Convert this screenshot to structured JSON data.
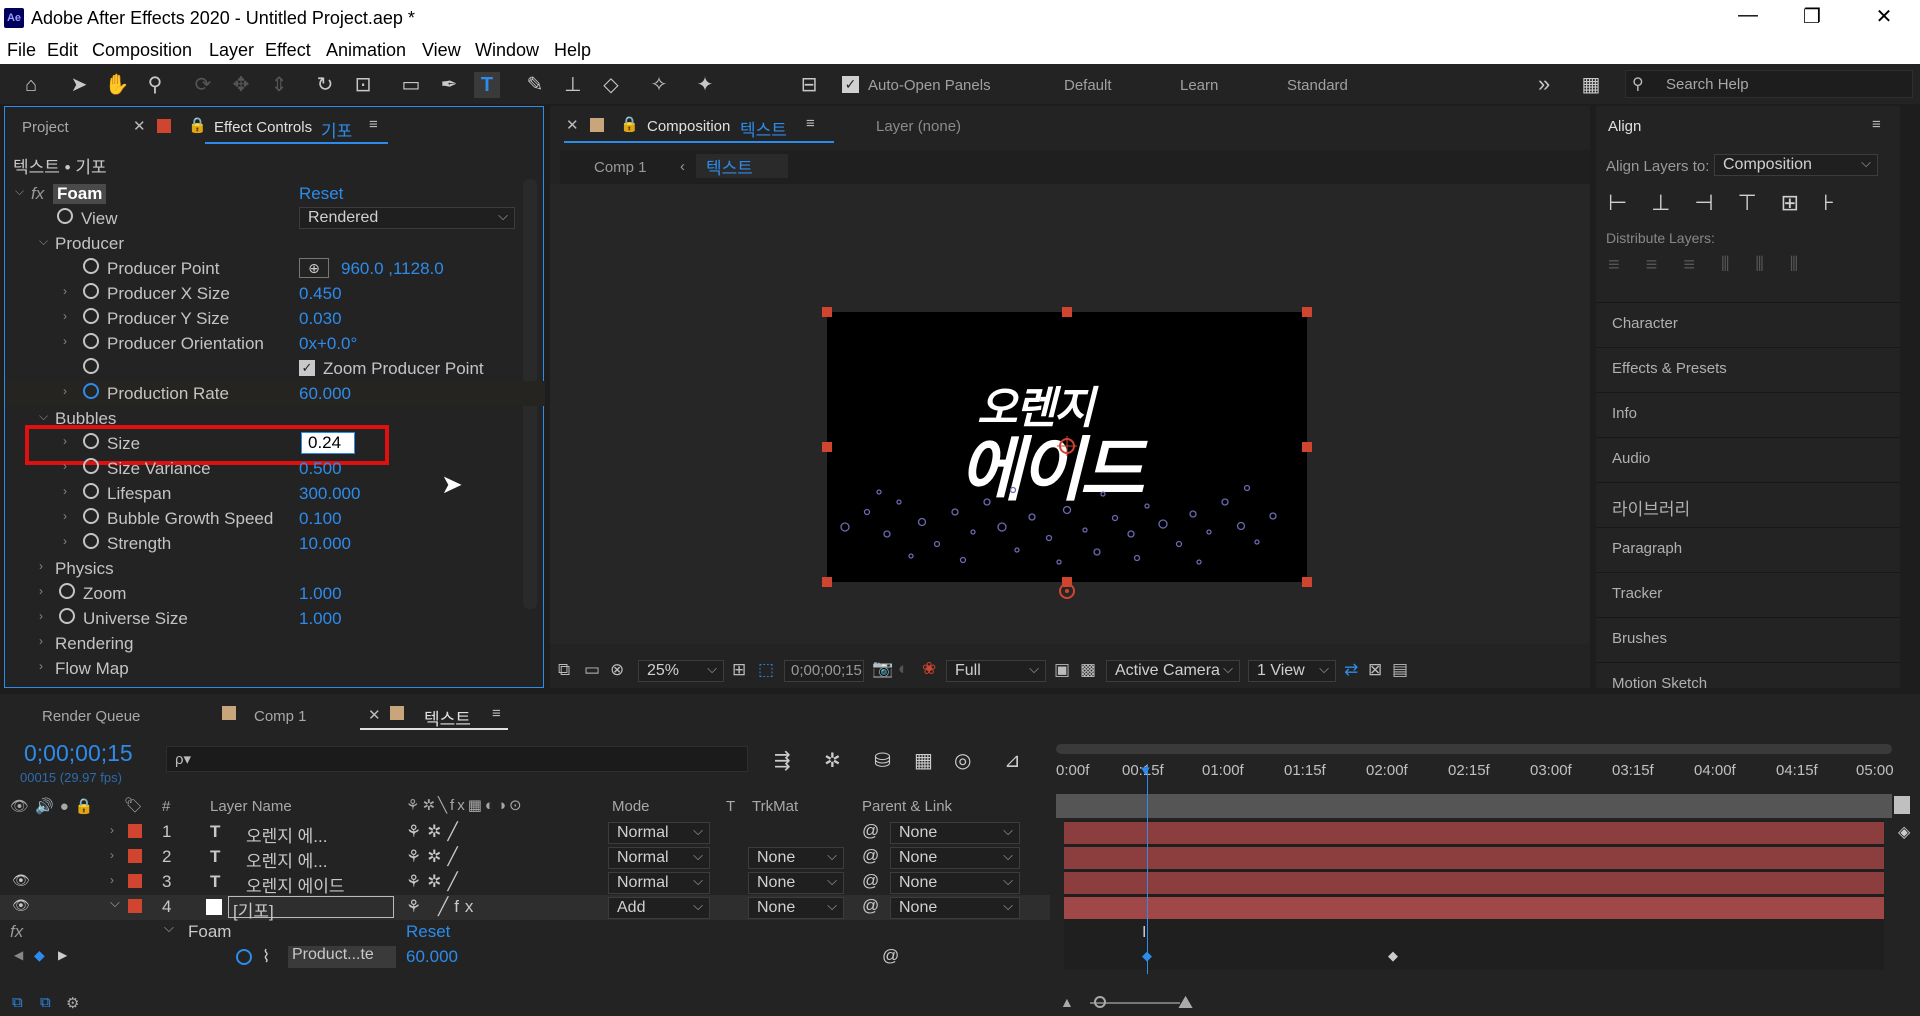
{
  "window": {
    "title": "Adobe After Effects 2020 - Untitled Project.aep *",
    "logo": "Ae",
    "minimize": "—",
    "restore": "❐",
    "close": "✕"
  },
  "menu": [
    "File",
    "Edit",
    "Composition",
    "Layer",
    "Effect",
    "Animation",
    "View",
    "Window",
    "Help"
  ],
  "toolbar": {
    "auto_open": "Auto-Open Panels",
    "workspaces": [
      "Default",
      "Learn",
      "Standard"
    ],
    "more": "»",
    "search_placeholder": "Search Help"
  },
  "effect_panel": {
    "tab_project": "Project",
    "tab_label": "Effect Controls",
    "tab_layer": "기포",
    "path": "텍스트 • 기포",
    "effect_name": "Foam",
    "reset": "Reset",
    "rows": [
      {
        "label": "View",
        "value": "Rendered"
      },
      {
        "label": "Producer"
      },
      {
        "label": "Producer Point",
        "value": "960.0 ,1128.0"
      },
      {
        "label": "Producer X Size",
        "value": "0.450"
      },
      {
        "label": "Producer Y Size",
        "value": "0.030"
      },
      {
        "label": "Producer Orientation",
        "value": "0x+0.0°"
      },
      {
        "label": "Zoom Producer Point"
      },
      {
        "label": "Production Rate",
        "value": "60.000"
      },
      {
        "label": "Bubbles"
      },
      {
        "label": "Size",
        "value": "0.24"
      },
      {
        "label": "Size Variance",
        "value": "0.500"
      },
      {
        "label": "Lifespan",
        "value": "300.000"
      },
      {
        "label": "Bubble Growth Speed",
        "value": "0.100"
      },
      {
        "label": "Strength",
        "value": "10.000"
      },
      {
        "label": "Physics"
      },
      {
        "label": "Zoom",
        "value": "1.000"
      },
      {
        "label": "Universe Size",
        "value": "1.000"
      },
      {
        "label": "Rendering"
      },
      {
        "label": "Flow Map"
      }
    ]
  },
  "comp_panel": {
    "tab_label": "Composition",
    "tab_comp": "텍스트",
    "layer_tab": "Layer (none)",
    "breadcrumb_1": "Comp 1",
    "breadcrumb_2": "텍스트",
    "art_line1": "오렌지",
    "art_line2": "에이드",
    "zoom": "25%",
    "timecode": "0;00;00;15",
    "resolution": "Full",
    "camera": "Active Camera",
    "views": "1 View"
  },
  "right_panel": {
    "align_title": "Align",
    "align_to_label": "Align Layers to:",
    "align_to_value": "Composition",
    "distribute_label": "Distribute Layers:",
    "panels": [
      "Character",
      "Effects & Presets",
      "Info",
      "Audio",
      "라이브러리",
      "Paragraph",
      "Tracker",
      "Brushes",
      "Motion Sketch"
    ]
  },
  "timeline": {
    "tabs": [
      "Render Queue",
      "Comp 1",
      "텍스트"
    ],
    "timecode": "0;00;00;15",
    "fps": "00015 (29.97 fps)",
    "search_placeholder": "ρ▾",
    "columns": {
      "num": "#",
      "name": "Layer Name",
      "mode": "Mode",
      "t": "T",
      "trkmat": "TrkMat",
      "parent": "Parent & Link"
    },
    "ruler": [
      "0:00f",
      "00:15f",
      "01:00f",
      "01:15f",
      "02:00f",
      "02:15f",
      "03:00f",
      "03:15f",
      "04:00f",
      "04:15f",
      "05:00"
    ],
    "layers": [
      {
        "num": "1",
        "type": "T",
        "name": "오렌지 에...",
        "mode": "Normal",
        "trkmat": "",
        "parent": "None"
      },
      {
        "num": "2",
        "type": "T",
        "name": "오렌지 에...",
        "mode": "Normal",
        "trkmat": "None",
        "parent": "None"
      },
      {
        "num": "3",
        "type": "T",
        "name": "오렌지 에이드",
        "mode": "Normal",
        "trkmat": "None",
        "parent": "None"
      },
      {
        "num": "4",
        "type": "",
        "name": "[기포]",
        "mode": "Add",
        "trkmat": "None",
        "parent": "None"
      }
    ],
    "effect": {
      "name": "Foam",
      "reset": "Reset",
      "prop": "Product...te",
      "prop_value": "60.000"
    }
  },
  "colors": {
    "accent": "#2d8ceb",
    "label_red": "#d04530",
    "bar": "#8c3d3d",
    "highlight_box": "#e01010"
  }
}
